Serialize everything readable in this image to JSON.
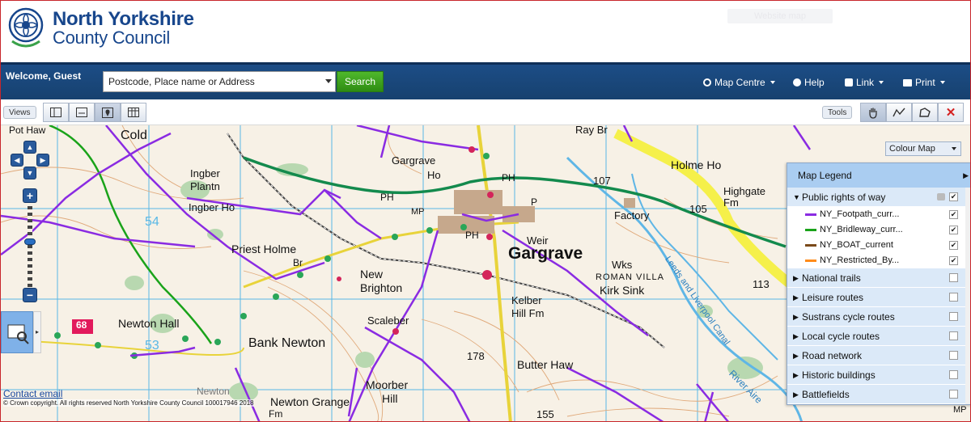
{
  "header": {
    "org_line1": "North Yorkshire",
    "org_line2": "County Council",
    "ghost_button": "Website map"
  },
  "nav": {
    "welcome": "Welcome, Guest",
    "search_placeholder": "Postcode, Place name or Address",
    "search_button": "Search",
    "map_centre": "Map Centre",
    "help": "Help",
    "link": "Link",
    "print": "Print"
  },
  "toolbar": {
    "views_label": "Views",
    "tools_label": "Tools"
  },
  "map": {
    "colour_map": "Colour Map",
    "labels": {
      "pot_haw": "Pot Haw",
      "cold": "Cold",
      "gargrave_ho": "Gargrave",
      "gargrave_ho2": "Ho",
      "ray_br": "Ray Br",
      "holme_ho": "Holme Ho",
      "ingber_plantn": "Ingber",
      "ingber_plantn2": "Plantn",
      "ingber_ho": "Ingber Ho",
      "highgate_fm": "Highgate",
      "highgate_fm2": "Fm",
      "factory": "Factory",
      "weir": "Weir",
      "gargrave": "Gargrave",
      "priest_holme": "Priest Holme",
      "new_brighton": "New",
      "new_brighton2": "Brighton",
      "roman_villa": "ROMAN VILLA",
      "kirk_sink": "Kirk Sink",
      "wks": "Wks",
      "kelber_hill": "Kelber",
      "kelber_hill2": "Hill Fm",
      "newton_hall": "Newton Hall",
      "scaleber": "Scaleber",
      "bank_newton": "Bank Newton",
      "butter_haw": "Butter Haw",
      "moorber_hill": "Moorber",
      "moorber_hill2": "Hill",
      "newton_grange": "Newton Grange",
      "newton": "Newton",
      "mp1": "MP",
      "mp2": "MP",
      "ph1": "PH",
      "ph2": "PH",
      "ph3": "PH",
      "p": "P",
      "br": "Br",
      "fm": "Fm",
      "h107": "107",
      "h105": "105",
      "h113": "113",
      "h178": "178",
      "h155": "155",
      "r68": "68",
      "leeds_canal": "Leeds and Liverpool Canal",
      "river": "River Aire",
      "grid54": "54",
      "grid53": "53"
    }
  },
  "legend": {
    "title": "Map Legend",
    "group_prow": "Public rights of way",
    "layers": [
      {
        "label": "NY_Footpath_curr...",
        "color": "#8a2be2"
      },
      {
        "label": "NY_Bridleway_curr...",
        "color": "#1aa31a"
      },
      {
        "label": "NY_BOAT_current",
        "color": "#7a4a1a"
      },
      {
        "label": "NY_Restricted_By...",
        "color": "#ff8c1a"
      }
    ],
    "groups": [
      "National trails",
      "Leisure routes",
      "Sustrans cycle routes",
      "Local cycle routes",
      "Road network",
      "Historic buildings",
      "Battlefields"
    ]
  },
  "footer": {
    "contact": "Contact email",
    "copyright": "© Crown copyright. All rights reserved North Yorkshire County Council 100017946 2018"
  }
}
